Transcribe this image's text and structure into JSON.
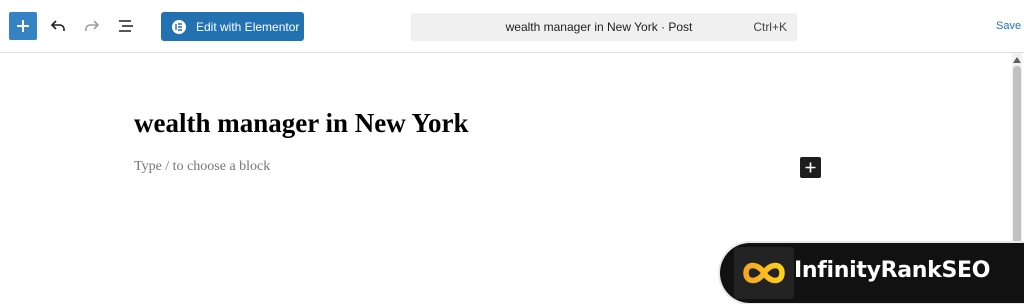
{
  "toolbar": {
    "inserter_icon": "plus-icon",
    "undo_icon": "undo-icon",
    "redo_icon": "redo-icon",
    "document_overview_icon": "list-view-icon",
    "elementor_label": "Edit with Elementor",
    "command_title": "wealth manager in New York · Post",
    "command_shortcut": "Ctrl+K",
    "save_draft_label": "Save d"
  },
  "editor": {
    "post_title": "wealth manager in New York",
    "block_placeholder": "Type / to choose a block",
    "add_block_icon": "plus-icon"
  },
  "watermark": {
    "brand_name": "InfinityRankSEO"
  },
  "colors": {
    "accent": "#2271b1",
    "inserter": "#3582c4",
    "logo_orange": "#f5a623",
    "logo_yellow": "#ffd11a"
  }
}
